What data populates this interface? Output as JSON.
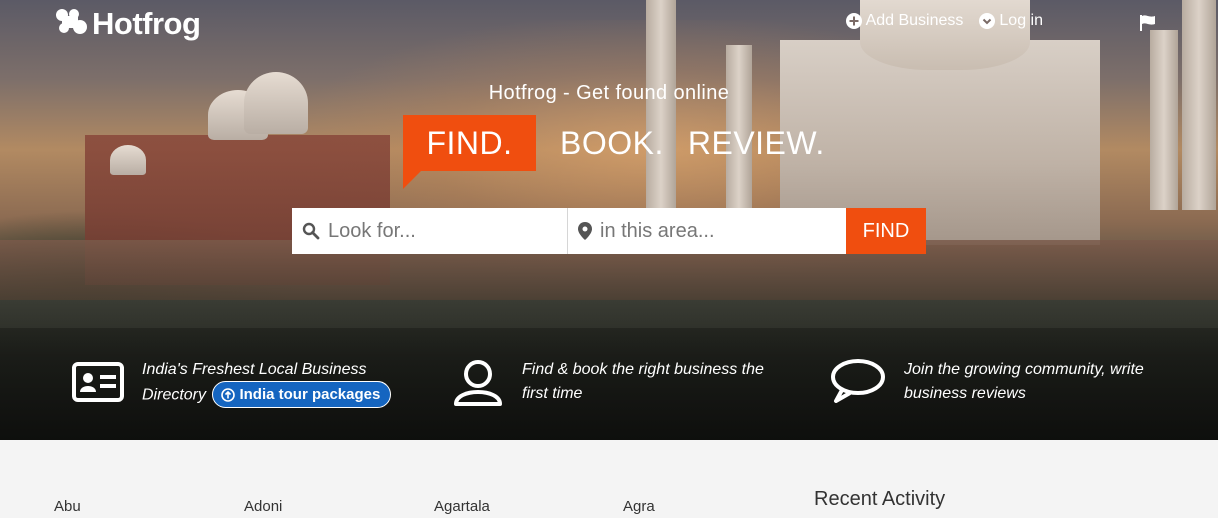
{
  "brand": {
    "name": "Hotfrog",
    "color": "#ffffff"
  },
  "nav": {
    "add_business": "Add Business",
    "login": "Log in",
    "add_icon": "plus-circle-icon",
    "login_icon": "chevron-circle-icon",
    "flag_icon": "flag-icon"
  },
  "hero": {
    "tagline": "Hotfrog - Get found online",
    "headline": {
      "find": "FIND.",
      "book": "BOOK.",
      "review": "REVIEW."
    },
    "accent": "#f04e0f"
  },
  "search": {
    "what_placeholder": "Look for...",
    "where_placeholder": "in this area...",
    "what_value": "",
    "where_value": "",
    "button": "FIND",
    "what_icon": "search-icon",
    "where_icon": "location-pin-icon"
  },
  "features": [
    {
      "icon": "id-card-icon",
      "text_line1": "India's Freshest Local Business",
      "text_line2": "Directory",
      "pill": "India tour packages",
      "pill_icon": "arrow-up-circle-icon",
      "pill_color": "#1565c0"
    },
    {
      "icon": "user-icon",
      "text": "Find & book the right business the first time"
    },
    {
      "icon": "speech-bubble-icon",
      "text": "Join the growing community, write business reviews"
    }
  ],
  "cities": [
    "Abu",
    "Adoni",
    "Agartala",
    "Agra"
  ],
  "recent_activity": {
    "title": "Recent Activity"
  }
}
